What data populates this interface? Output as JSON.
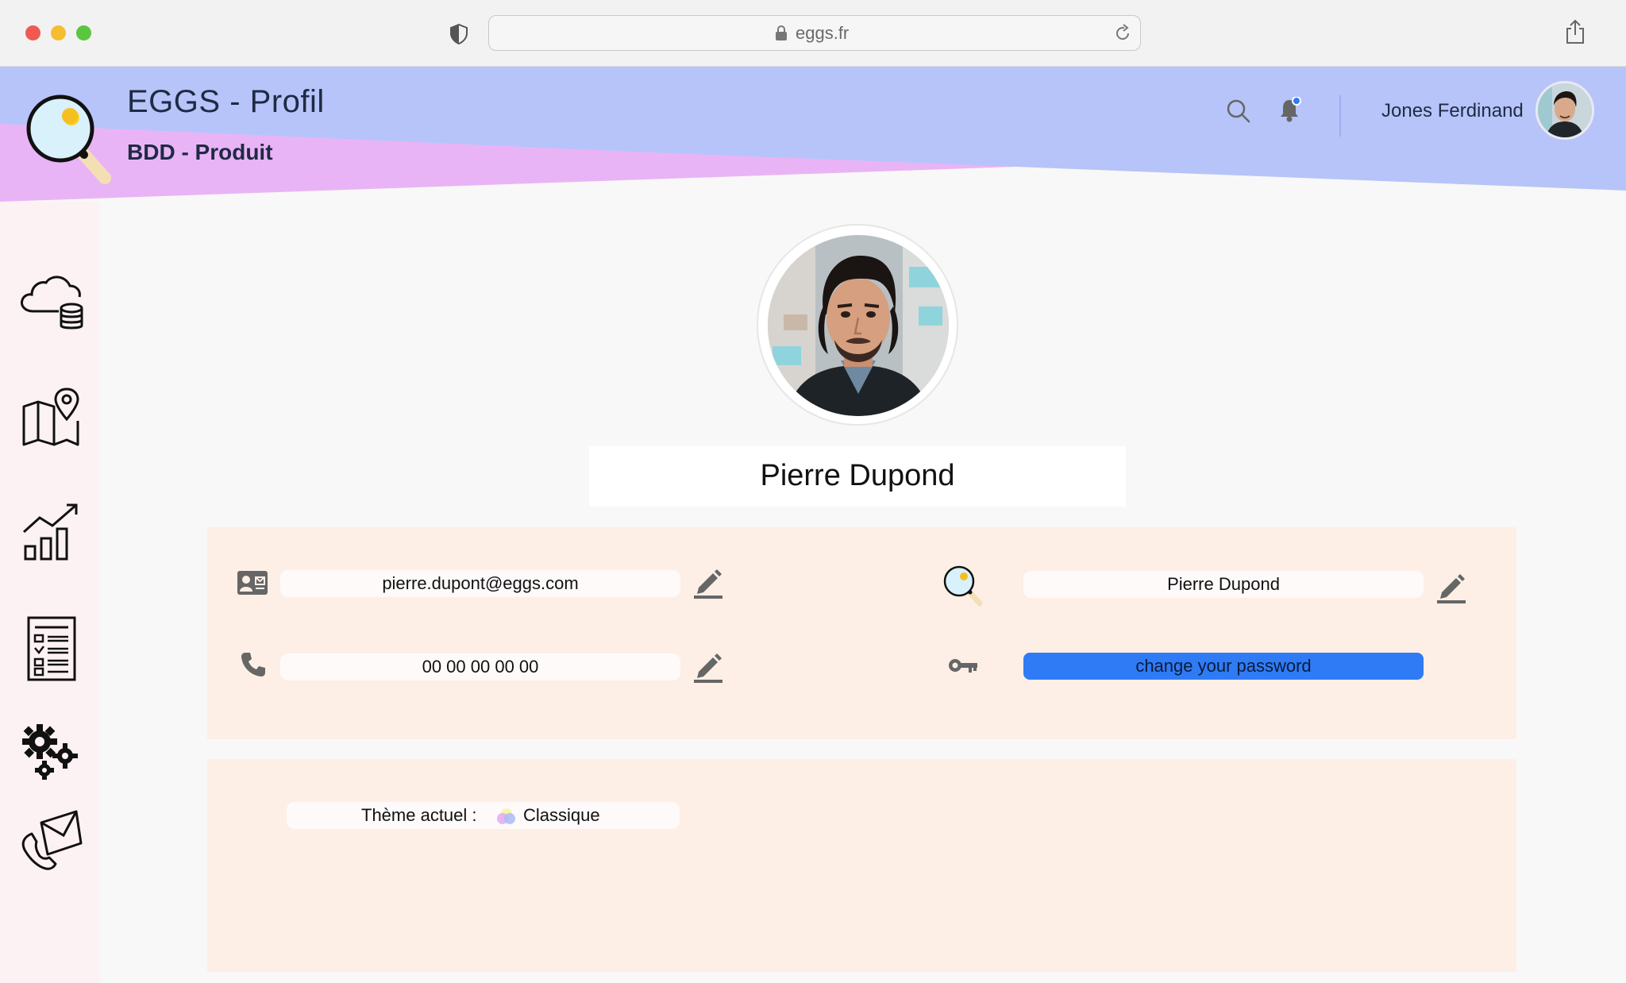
{
  "browser": {
    "url": "eggs.fr"
  },
  "header": {
    "title": "EGGS - Profil",
    "subtitle": "BDD - Produit",
    "user_name": "Jones Ferdinand"
  },
  "sidebar": {
    "items": [
      {
        "icon": "cloud-database-icon"
      },
      {
        "icon": "map-location-icon"
      },
      {
        "icon": "growth-chart-icon"
      },
      {
        "icon": "checklist-icon"
      },
      {
        "icon": "gears-icon"
      },
      {
        "icon": "mail-phone-icon"
      }
    ]
  },
  "profile": {
    "full_name": "Pierre Dupond",
    "email": "pierre.dupont@eggs.com",
    "phone": "00 00 00 00 00",
    "display_name": "Pierre Dupond",
    "password_button": "change your password"
  },
  "theme": {
    "label": "Thème actuel :",
    "value": "Classique"
  },
  "colors": {
    "header_blue": "#b7c4f9",
    "header_pink": "#e9b4f6",
    "header_yellow": "#f6fbd0",
    "card_bg": "#fdefe6",
    "accent": "#2f7bf5",
    "sidebar_bg": "#fdf2f3"
  }
}
